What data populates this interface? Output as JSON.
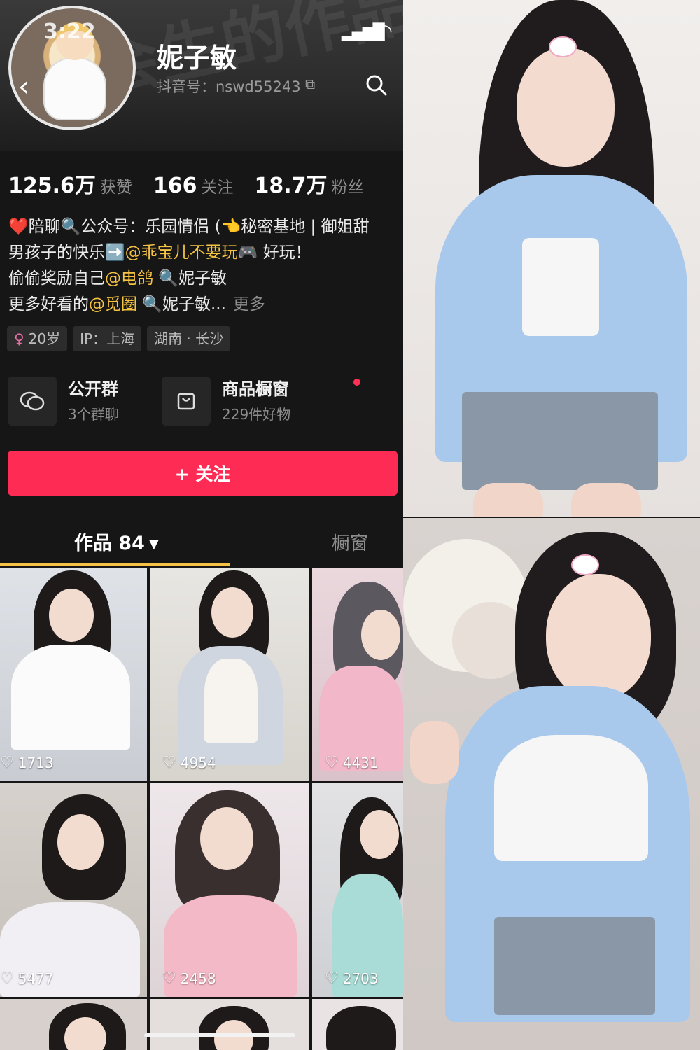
{
  "status": {
    "time": "3:22"
  },
  "profile": {
    "nickname": "妮子敏",
    "douyin_id": "抖音号：nswd55243",
    "header_watermark": "是会生的作品"
  },
  "stats": [
    {
      "value": "125.6万",
      "label": "获赞"
    },
    {
      "value": "166",
      "label": "关注"
    },
    {
      "value": "18.7万",
      "label": "粉丝"
    }
  ],
  "bio": {
    "line1": "❤️陪聊🔍公众号：乐园情侣 (👈秘密基地 | 御姐甜",
    "line2_prefix": "男孩子的快乐➡️",
    "line2_mention": "@乖宝儿不要玩🎮",
    "line2_suffix": " 好玩！",
    "line3_prefix": "偷偷奖励自己",
    "line3_mention": "@电鸽",
    "line3_suffix": " 🔍妮子敏",
    "line4_prefix": "更多好看的",
    "line4_mention": "@觅圈",
    "line4_suffix": " 🔍妮子敏...",
    "more": "更多"
  },
  "tags": [
    {
      "icon": "female-icon",
      "text": "20岁"
    },
    {
      "text": "IP：上海"
    },
    {
      "text": "湖南 · 长沙"
    }
  ],
  "cards": {
    "group": {
      "title": "公开群",
      "sub": "3个群聊"
    },
    "shop": {
      "title": "商品橱窗",
      "sub": "229件好物"
    }
  },
  "follow_button": "+ 关注",
  "tabs": {
    "works": "作品 84",
    "shop": "橱窗"
  },
  "videos": [
    {
      "likes": "1713"
    },
    {
      "likes": "4954"
    },
    {
      "likes": "4431"
    },
    {
      "likes": "5477"
    },
    {
      "likes": "2458"
    },
    {
      "likes": "2703"
    }
  ],
  "colors": {
    "background": "#161616",
    "follow_button": "#fe2c55",
    "mention": "#f5c243",
    "tab_underline": "#f5c243"
  }
}
